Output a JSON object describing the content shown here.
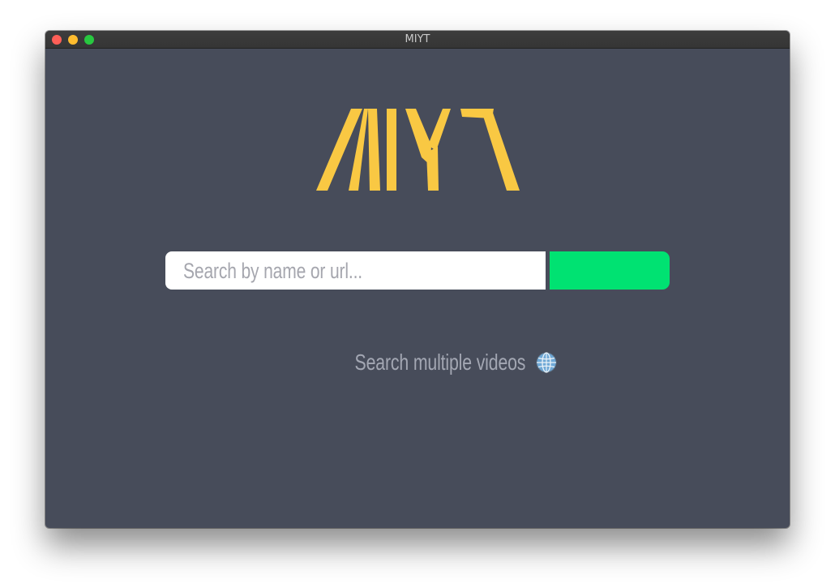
{
  "window": {
    "title": "MIYT"
  },
  "logo": {
    "text": "MIYT",
    "color": "#f9c843"
  },
  "search": {
    "placeholder": "Search by name or url...",
    "value": "",
    "button_color": "#00e272"
  },
  "multi_search": {
    "label": "Search multiple videos",
    "icon": "globe-icon"
  },
  "colors": {
    "background": "#474c5a",
    "accent": "#f9c843",
    "button": "#00e272"
  }
}
